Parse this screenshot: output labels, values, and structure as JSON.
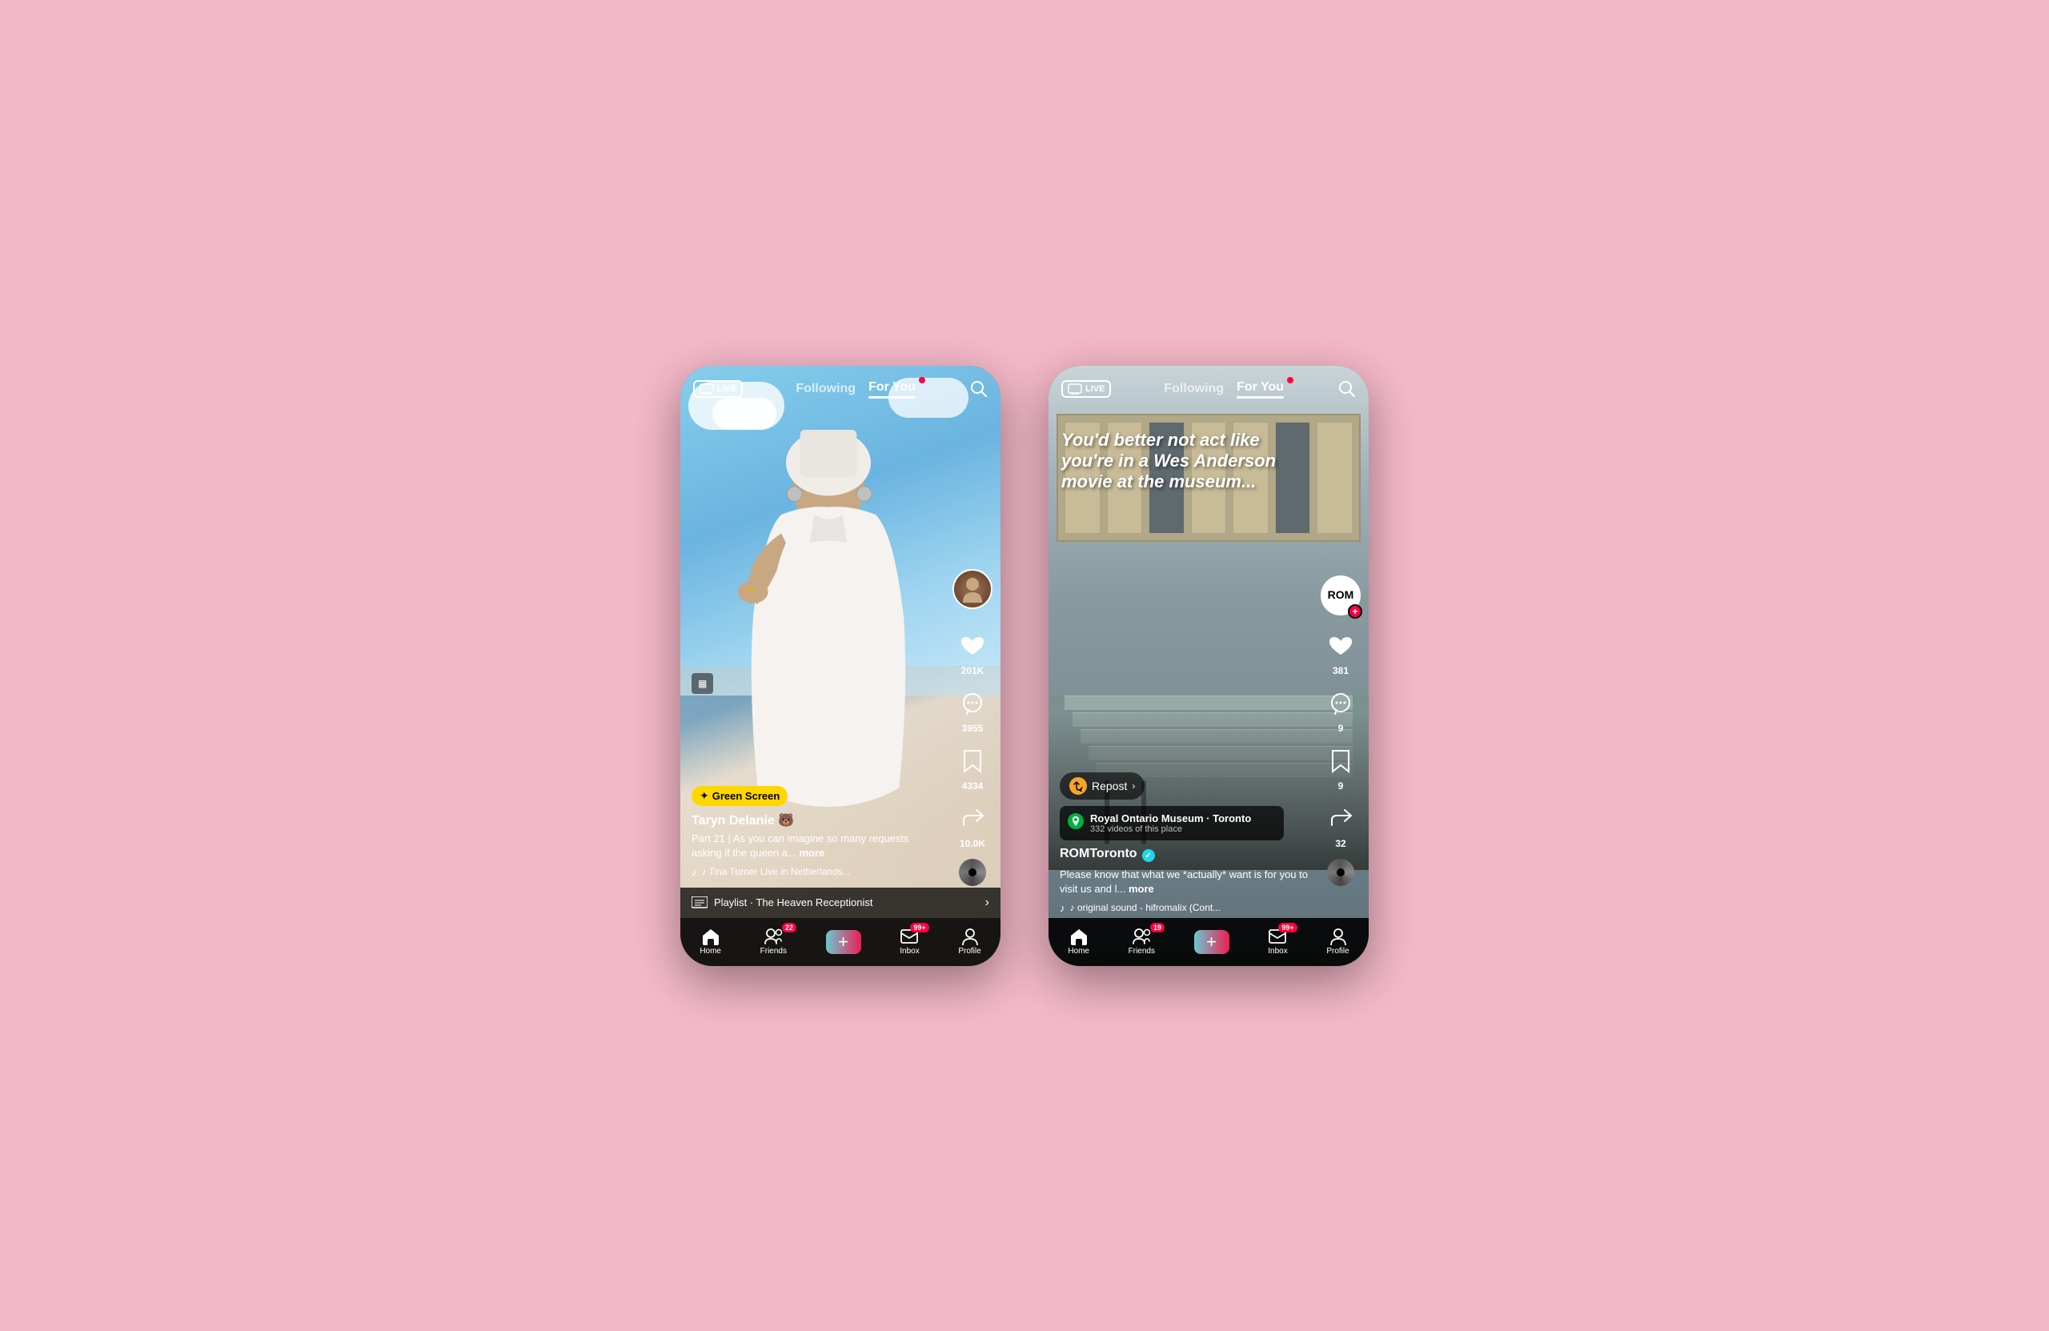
{
  "app": {
    "background_color": "#f4b8c8"
  },
  "phone1": {
    "nav": {
      "live_label": "LIVE",
      "following_label": "Following",
      "foryou_label": "For You",
      "has_notification": true
    },
    "video": {
      "creator": "Taryn Delanie 🐻",
      "description": "Part 21 | As you can imagine so many requests asking if the queen a...",
      "more_label": "more",
      "music": "♪ Tina Turner Live in Netherlands...",
      "effect_label": "Green Screen",
      "playlist_label": "Playlist · The Heaven Receptionist"
    },
    "actions": {
      "likes": "201K",
      "comments": "3955",
      "bookmarks": "4334",
      "shares": "10.0K"
    },
    "bottom_nav": {
      "home_label": "Home",
      "friends_label": "Friends",
      "friends_badge": "22",
      "inbox_label": "Inbox",
      "inbox_badge": "99+",
      "profile_label": "Profile"
    }
  },
  "phone2": {
    "nav": {
      "live_label": "LIVE",
      "following_label": "Following",
      "foryou_label": "For You",
      "has_notification": true
    },
    "video": {
      "title": "You'd better not act like you're in a Wes Anderson movie at the museum...",
      "repost_label": "Repost",
      "location_name": "Royal Ontario Museum · Toronto",
      "location_count": "332 videos of this place",
      "creator": "ROMToronto",
      "is_verified": true,
      "description": "Please know that what we *actually* want is for you to visit us and l...",
      "more_label": "more",
      "music": "♪ original sound - hifromalix (Cont..."
    },
    "actions": {
      "likes": "381",
      "comments": "9",
      "bookmarks": "9",
      "shares": "32"
    },
    "bottom_nav": {
      "home_label": "Home",
      "friends_label": "Friends",
      "friends_badge": "19",
      "inbox_label": "Inbox",
      "inbox_badge": "99+",
      "profile_label": "Profile"
    }
  }
}
